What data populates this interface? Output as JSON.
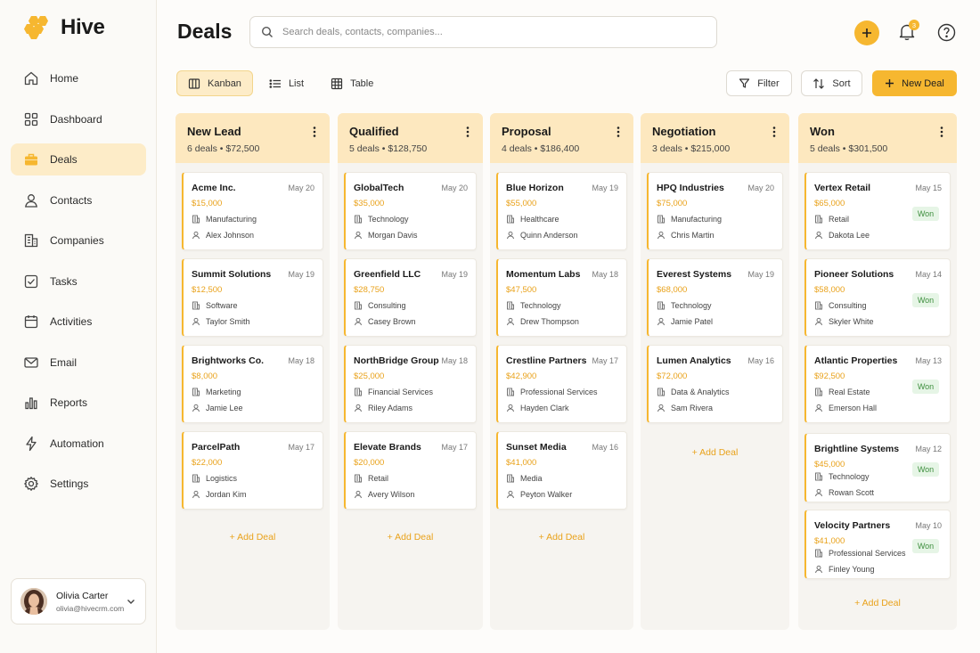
{
  "app": {
    "name": "Hive"
  },
  "page": {
    "title": "Deals"
  },
  "search": {
    "placeholder": "Search deals, contacts, companies..."
  },
  "notifications": {
    "count": "3"
  },
  "sidebar": {
    "items": [
      {
        "label": "Home",
        "icon": "home-icon"
      },
      {
        "label": "Dashboard",
        "icon": "dashboard-icon"
      },
      {
        "label": "Deals",
        "icon": "briefcase-icon",
        "active": true
      },
      {
        "label": "Contacts",
        "icon": "user-icon"
      },
      {
        "label": "Companies",
        "icon": "building-icon"
      },
      {
        "label": "Tasks",
        "icon": "checkbox-icon"
      },
      {
        "label": "Activities",
        "icon": "calendar-icon"
      },
      {
        "label": "Email",
        "icon": "mail-icon"
      },
      {
        "label": "Reports",
        "icon": "bar-chart-icon"
      },
      {
        "label": "Automation",
        "icon": "lightning-icon"
      },
      {
        "label": "Settings",
        "icon": "gear-icon"
      }
    ]
  },
  "user": {
    "name": "Olivia Carter",
    "email": "olivia@hivecrm.com"
  },
  "views": {
    "kanban": "Kanban",
    "list": "List",
    "table": "Table",
    "active": "Kanban"
  },
  "toolbar": {
    "filter": "Filter",
    "sort": "Sort",
    "new_deal": "New Deal"
  },
  "colors": {
    "accent": "#f6b730",
    "header": "#fde8bf",
    "won": "#3f8f3f"
  },
  "add_deal_label": "+ Add Deal",
  "columns": [
    {
      "title": "New Lead",
      "meta": "6 deals • $72,500",
      "cards": [
        {
          "name": "Acme Inc.",
          "date": "May 20",
          "value": "$15,000",
          "industry": "Manufacturing",
          "contact": "Alex Johnson"
        },
        {
          "name": "Summit Solutions",
          "date": "May 19",
          "value": "$12,500",
          "industry": "Software",
          "contact": "Taylor Smith"
        },
        {
          "name": "Brightworks Co.",
          "date": "May 18",
          "value": "$8,000",
          "industry": "Marketing",
          "contact": "Jamie Lee"
        },
        {
          "name": "ParcelPath",
          "date": "May 17",
          "value": "$22,000",
          "industry": "Logistics",
          "contact": "Jordan Kim"
        }
      ]
    },
    {
      "title": "Qualified",
      "meta": "5 deals • $128,750",
      "cards": [
        {
          "name": "GlobalTech",
          "date": "May 20",
          "value": "$35,000",
          "industry": "Technology",
          "contact": "Morgan Davis"
        },
        {
          "name": "Greenfield LLC",
          "date": "May 19",
          "value": "$28,750",
          "industry": "Consulting",
          "contact": "Casey Brown"
        },
        {
          "name": "NorthBridge Group",
          "date": "May 18",
          "value": "$25,000",
          "industry": "Financial Services",
          "contact": "Riley Adams"
        },
        {
          "name": "Elevate Brands",
          "date": "May 17",
          "value": "$20,000",
          "industry": "Retail",
          "contact": "Avery Wilson"
        }
      ]
    },
    {
      "title": "Proposal",
      "meta": "4 deals • $186,400",
      "cards": [
        {
          "name": "Blue Horizon",
          "date": "May 19",
          "value": "$55,000",
          "industry": "Healthcare",
          "contact": "Quinn Anderson"
        },
        {
          "name": "Momentum Labs",
          "date": "May 18",
          "value": "$47,500",
          "industry": "Technology",
          "contact": "Drew Thompson"
        },
        {
          "name": "Crestline Partners",
          "date": "May 17",
          "value": "$42,900",
          "industry": "Professional Services",
          "contact": "Hayden Clark"
        },
        {
          "name": "Sunset Media",
          "date": "May 16",
          "value": "$41,000",
          "industry": "Media",
          "contact": "Peyton Walker"
        }
      ]
    },
    {
      "title": "Negotiation",
      "meta": "3 deals • $215,000",
      "cards": [
        {
          "name": "HPQ Industries",
          "date": "May 20",
          "value": "$75,000",
          "industry": "Manufacturing",
          "contact": "Chris Martin"
        },
        {
          "name": "Everest Systems",
          "date": "May 19",
          "value": "$68,000",
          "industry": "Technology",
          "contact": "Jamie Patel"
        },
        {
          "name": "Lumen Analytics",
          "date": "May 16",
          "value": "$72,000",
          "industry": "Data & Analytics",
          "contact": "Sam Rivera"
        }
      ]
    },
    {
      "title": "Won",
      "meta": "5 deals • $301,500",
      "cards": [
        {
          "name": "Vertex Retail",
          "date": "May 15",
          "value": "$65,000",
          "industry": "Retail",
          "contact": "Dakota Lee",
          "badge": "Won"
        },
        {
          "name": "Pioneer Solutions",
          "date": "May 14",
          "value": "$58,000",
          "industry": "Consulting",
          "contact": "Skyler White",
          "badge": "Won"
        },
        {
          "name": "Atlantic Properties",
          "date": "May 13",
          "value": "$92,500",
          "industry": "Real Estate",
          "contact": "Emerson Hall",
          "badge": "Won"
        },
        {
          "name": "Brightline Systems",
          "date": "May 12",
          "value": "$45,000",
          "industry": "Technology",
          "contact": "Rowan Scott",
          "badge": "Won"
        },
        {
          "name": "Velocity Partners",
          "date": "May 10",
          "value": "$41,000",
          "industry": "Professional Services",
          "contact": "Finley Young",
          "badge": "Won"
        }
      ]
    }
  ]
}
